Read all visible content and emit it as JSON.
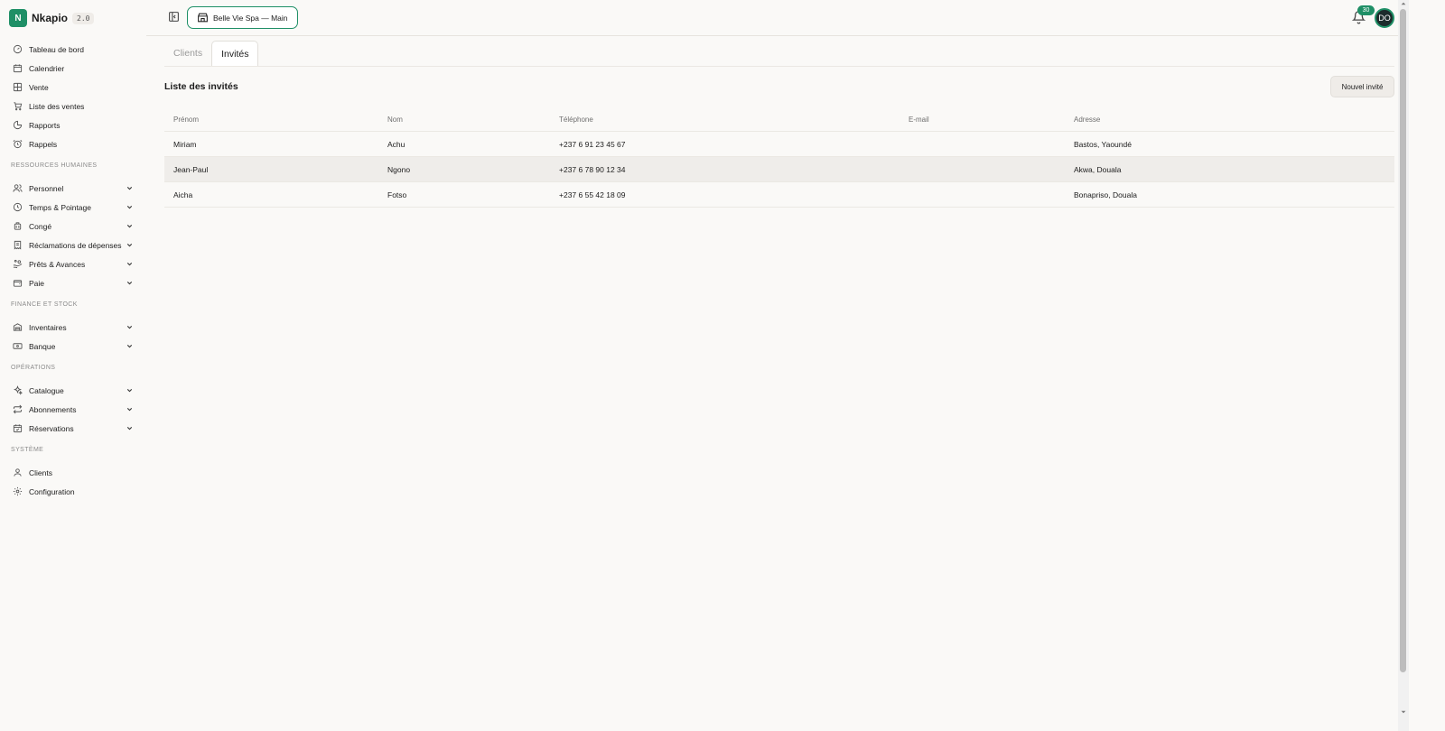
{
  "brand": {
    "logo_letter": "N",
    "name": "Nkapio",
    "version": "2.0"
  },
  "sidebar": {
    "main_items": [
      {
        "label": "Tableau de bord",
        "icon": "gauge-icon"
      },
      {
        "label": "Calendrier",
        "icon": "calendar-icon"
      },
      {
        "label": "Vente",
        "icon": "grid-icon"
      },
      {
        "label": "Liste des ventes",
        "icon": "cart-icon"
      },
      {
        "label": "Rapports",
        "icon": "pie-chart-icon"
      },
      {
        "label": "Rappels",
        "icon": "alarm-icon"
      }
    ],
    "hr_title": "RESSOURCES HUMAINES",
    "hr_items": [
      {
        "label": "Personnel",
        "icon": "users-icon"
      },
      {
        "label": "Temps & Pointage",
        "icon": "clock-icon"
      },
      {
        "label": "Congé",
        "icon": "luggage-icon"
      },
      {
        "label": "Réclamations de dépenses",
        "icon": "receipt-icon"
      },
      {
        "label": "Prêts & Avances",
        "icon": "handcoins-icon"
      },
      {
        "label": "Paie",
        "icon": "wallet-icon"
      }
    ],
    "finance_title": "FINANCE ET STOCK",
    "finance_items": [
      {
        "label": "Inventaires",
        "icon": "warehouse-icon"
      },
      {
        "label": "Banque",
        "icon": "banknote-icon"
      }
    ],
    "ops_title": "OPÉRATIONS",
    "ops_items": [
      {
        "label": "Catalogue",
        "icon": "sparkles-icon"
      },
      {
        "label": "Abonnements",
        "icon": "repeat-icon"
      },
      {
        "label": "Réservations",
        "icon": "calendar-check-icon"
      }
    ],
    "system_title": "SYSTÈME",
    "system_items": [
      {
        "label": "Clients",
        "icon": "user-icon"
      },
      {
        "label": "Configuration",
        "icon": "settings-icon"
      }
    ]
  },
  "topbar": {
    "store_label": "Belle Vie Spa — Main",
    "notification_count": "30",
    "avatar_initials": "DO"
  },
  "tabs": [
    {
      "label": "Clients",
      "active": false
    },
    {
      "label": "Invités",
      "active": true
    }
  ],
  "page": {
    "title": "Liste des invités",
    "new_button": "Nouvel invité"
  },
  "table": {
    "headers": [
      "Prénom",
      "Nom",
      "Téléphone",
      "E-mail",
      "Adresse"
    ],
    "rows": [
      {
        "first": "Miriam",
        "last": "Achu",
        "phone": "+237 6 91 23 45 67",
        "email": "",
        "address": "Bastos, Yaoundé"
      },
      {
        "first": "Jean-Paul",
        "last": "Ngono",
        "phone": "+237 6 78 90 12 34",
        "email": "",
        "address": "Akwa, Douala"
      },
      {
        "first": "Aicha",
        "last": "Fotso",
        "phone": "+237 6 55 42 18 09",
        "email": "",
        "address": "Bonapriso, Douala"
      }
    ]
  },
  "colors": {
    "accent": "#1f8f66",
    "background": "#faf9f7",
    "row_highlight": "#efedea"
  }
}
